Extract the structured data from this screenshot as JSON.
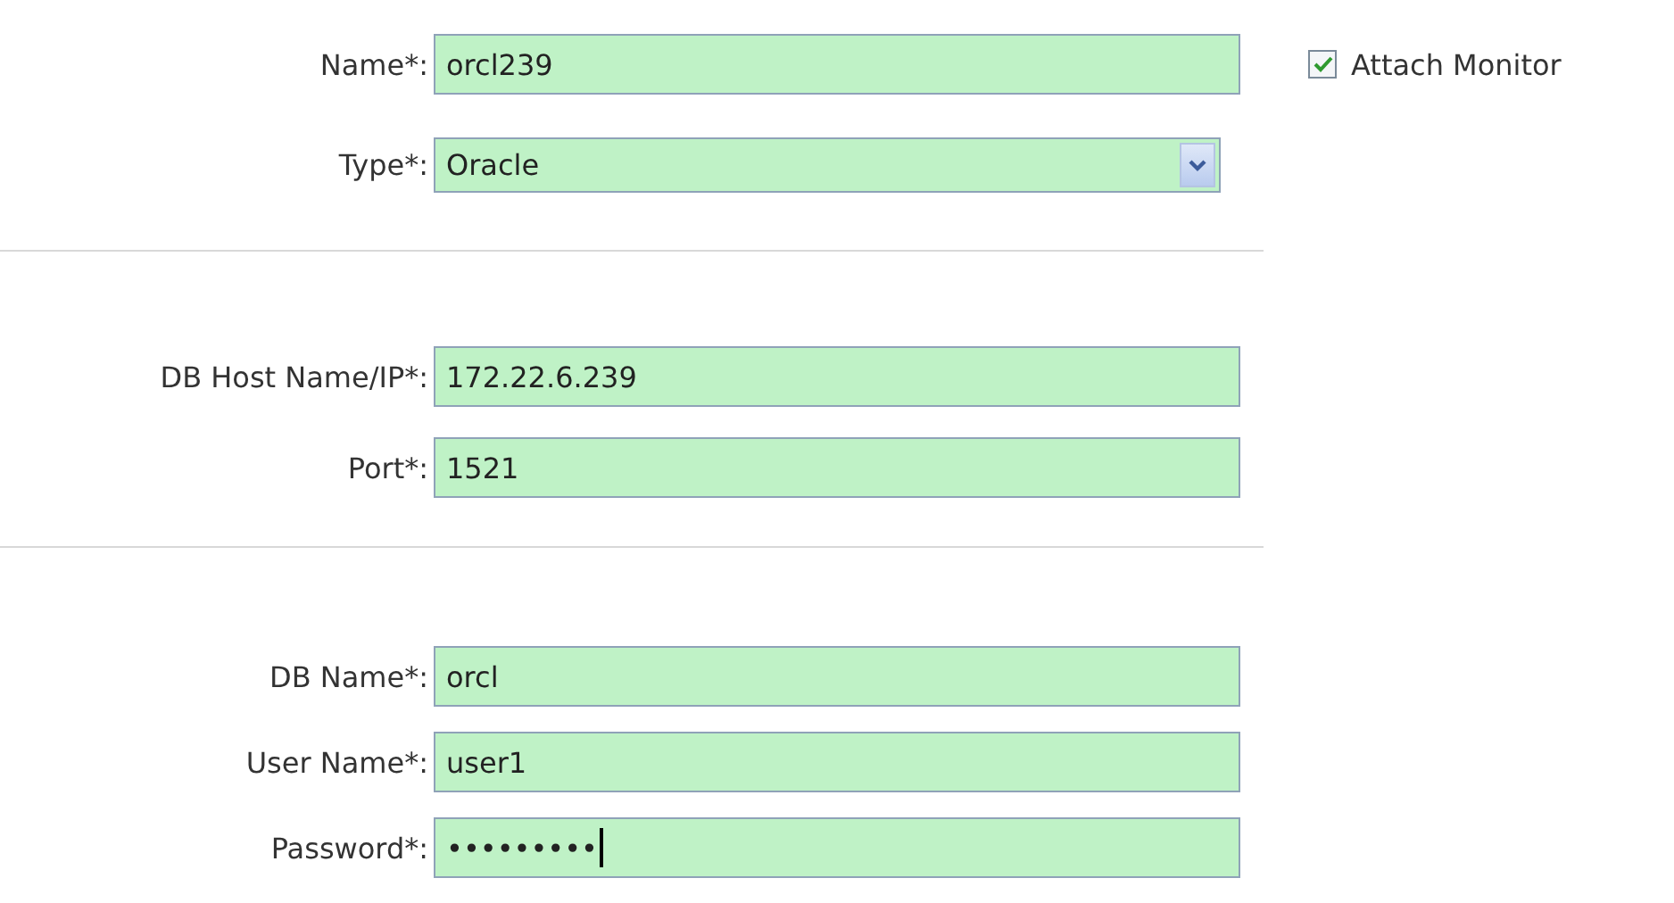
{
  "sections": [
    {
      "fields": [
        {
          "kind": "text",
          "label": "Name*:",
          "value": "orcl239",
          "checkbox": {
            "label": "Attach Monitor",
            "checked": true
          }
        },
        {
          "kind": "select",
          "label": "Type*:",
          "value": "Oracle"
        }
      ]
    },
    {
      "fields": [
        {
          "kind": "text",
          "label": "DB Host Name/IP*:",
          "value": "172.22.6.239"
        },
        {
          "kind": "text",
          "label": "Port*:",
          "value": "1521"
        }
      ]
    },
    {
      "fields": [
        {
          "kind": "text",
          "label": "DB Name*:",
          "value": "orcl"
        },
        {
          "kind": "text",
          "label": "User Name*:",
          "value": "user1"
        },
        {
          "kind": "password",
          "label": "Password*:",
          "value": "•••••••••",
          "focused": true
        }
      ]
    }
  ]
}
